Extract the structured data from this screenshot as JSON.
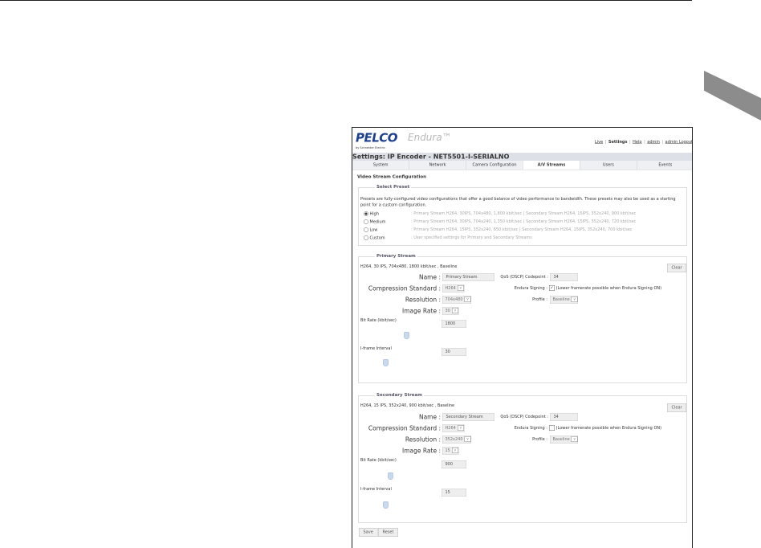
{
  "header": {
    "logo": "PELCO",
    "product": "Endura™",
    "byline": "by Schneider Electric",
    "links": [
      "Live",
      "Settings",
      "Help",
      "admin",
      "admin Logout"
    ]
  },
  "breadcrumb": "Settings: IP Encoder - NET5501-I-SERIALNO",
  "tabs": [
    "System",
    "Network",
    "Camera Configuration",
    "A/V Streams",
    "Users",
    "Events"
  ],
  "page_title": "Video Stream Configuration",
  "preset": {
    "legend": "Select Preset",
    "description": "Presets are fully-configured video configurations that offer a good balance of video performance to bandwidth. These presets may also be used as a starting point for a custom configuration.",
    "options": [
      {
        "label": "High",
        "detail": ": Primary Stream H264, 30IPS, 704x480, 1,800 kbit/sec | Secondary Stream H264, 15IPS, 352x240, 900 kbit/sec",
        "selected": true
      },
      {
        "label": "Medium",
        "detail": ": Primary Stream H264, 30IPS, 704x240, 1,350 kbit/sec | Secondary Stream H264, 15IPS, 352x240, 720 kbit/sec",
        "selected": false
      },
      {
        "label": "Low",
        "detail": ": Primary Stream H264, 15IPS, 352x240, 650 kbit/sec | Secondary Stream H264, 15IPS, 352x240, 700 kbit/sec",
        "selected": false
      },
      {
        "label": "Custom",
        "detail": ": User specified settings for Primary and Secondary Streams",
        "selected": false
      }
    ]
  },
  "labels": {
    "name": "Name :",
    "qos": "QoS (DSCP) Codepoint :",
    "compression": "Compression Standard :",
    "signing": "Endura Signing :",
    "signing_note": "(Lower framerate possible when Endura Signing ON)",
    "resolution": "Resolution :",
    "profile": "Profile :",
    "image_rate": "Image Rate :",
    "bit_rate": "Bit Rate (kbit/sec)",
    "iframe": "I-frame Interval",
    "clear": "Clear"
  },
  "primary": {
    "legend": "Primary Stream",
    "summary": "H264, 30 IPS, 704x480, 1800 kbit/sec , Baseline",
    "name": "Primary Stream",
    "qos": "34",
    "compression": "H264",
    "signing": true,
    "resolution": "704x480",
    "profile": "Baseline",
    "image_rate": "30",
    "bit_rate": "1800",
    "iframe": "30"
  },
  "secondary": {
    "legend": "Secondary Stream",
    "summary": "H264, 15 IPS, 352x240, 900 kbit/sec , Baseline",
    "name": "Secondary Stream",
    "qos": "34",
    "compression": "H264",
    "signing": false,
    "resolution": "352x240",
    "profile": "Baseline",
    "image_rate": "15",
    "bit_rate": "900",
    "iframe": "15"
  },
  "buttons": {
    "save": "Save",
    "reset": "Reset"
  }
}
